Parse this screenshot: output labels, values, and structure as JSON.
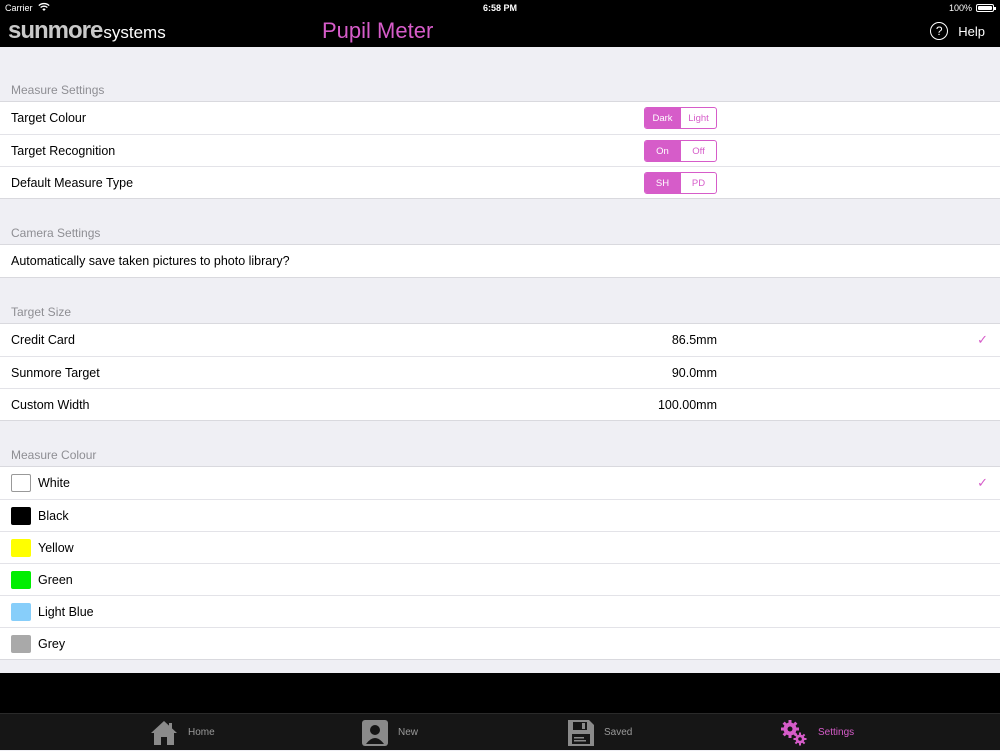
{
  "status": {
    "carrier": "Carrier",
    "time": "6:58 PM",
    "battery": "100%"
  },
  "nav": {
    "logo_big": "sunmore",
    "logo_small": "systems",
    "title": "Pupil Meter",
    "help": "Help",
    "help_icon_glyph": "?"
  },
  "measure_settings": {
    "header": "Measure Settings",
    "rows": [
      {
        "label": "Target Colour",
        "options": [
          "Dark",
          "Light"
        ],
        "selected": 0
      },
      {
        "label": "Target Recognition",
        "options": [
          "On",
          "Off"
        ],
        "selected": 0
      },
      {
        "label": "Default Measure Type",
        "options": [
          "SH",
          "PD"
        ],
        "selected": 0
      }
    ]
  },
  "camera_settings": {
    "header": "Camera Settings",
    "rows": [
      {
        "label": "Automatically save taken pictures to photo library?"
      }
    ]
  },
  "target_size": {
    "header": "Target Size",
    "rows": [
      {
        "label": "Credit Card",
        "value": "86.5mm",
        "checked": true
      },
      {
        "label": "Sunmore Target",
        "value": "90.0mm",
        "checked": false
      },
      {
        "label": "Custom Width",
        "value": "100.00mm",
        "checked": false
      }
    ]
  },
  "measure_colour": {
    "header": "Measure Colour",
    "rows": [
      {
        "label": "White",
        "color": "#ffffff",
        "checked": true
      },
      {
        "label": "Black",
        "color": "#000000",
        "checked": false
      },
      {
        "label": "Yellow",
        "color": "#ffff00",
        "checked": false
      },
      {
        "label": "Green",
        "color": "#00ee00",
        "checked": false
      },
      {
        "label": "Light Blue",
        "color": "#87cefa",
        "checked": false
      },
      {
        "label": "Grey",
        "color": "#a9a9a9",
        "checked": false
      }
    ]
  },
  "check_glyph": "✓",
  "tabs": {
    "home": "Home",
    "new": "New",
    "saved": "Saved",
    "settings": "Settings"
  },
  "colors": {
    "accent": "#d65cc9"
  }
}
